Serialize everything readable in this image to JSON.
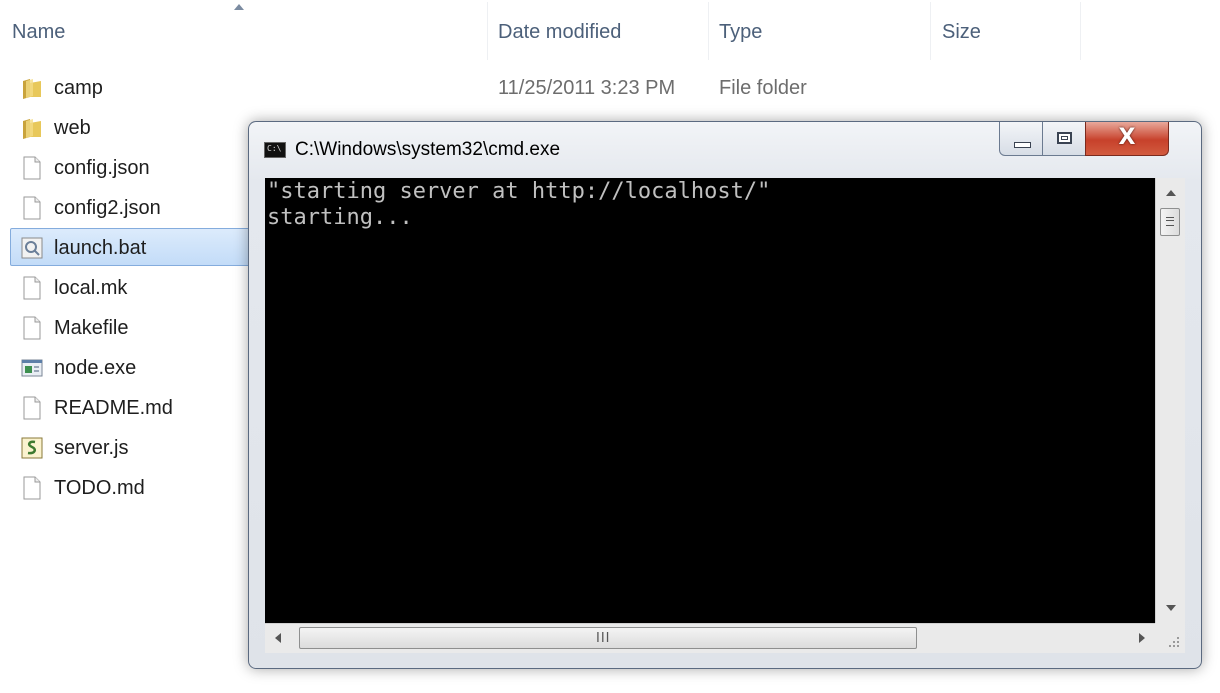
{
  "explorer": {
    "columns": {
      "name": "Name",
      "date_modified": "Date modified",
      "type": "Type",
      "size": "Size"
    },
    "files": [
      {
        "name": "camp",
        "date": "11/25/2011 3:23 PM",
        "type": "File folder",
        "icon": "folder-icon"
      },
      {
        "name": "web",
        "date": "",
        "type": "",
        "icon": "folder-icon"
      },
      {
        "name": "config.json",
        "date": "",
        "type": "",
        "icon": "file-icon"
      },
      {
        "name": "config2.json",
        "date": "",
        "type": "",
        "icon": "file-icon"
      },
      {
        "name": "launch.bat",
        "date": "",
        "type": "",
        "icon": "batch-file-icon",
        "selected": true
      },
      {
        "name": "local.mk",
        "date": "",
        "type": "",
        "icon": "file-icon"
      },
      {
        "name": "Makefile",
        "date": "",
        "type": "",
        "icon": "file-icon"
      },
      {
        "name": "node.exe",
        "date": "",
        "type": "",
        "icon": "executable-icon"
      },
      {
        "name": "README.md",
        "date": "",
        "type": "",
        "icon": "file-icon"
      },
      {
        "name": "server.js",
        "date": "",
        "type": "",
        "icon": "script-file-icon"
      },
      {
        "name": "TODO.md",
        "date": "",
        "type": "",
        "icon": "file-icon"
      }
    ]
  },
  "cmd": {
    "title": "C:\\Windows\\system32\\cmd.exe",
    "lines": [
      "\"starting server at http://localhost/\"",
      "starting..."
    ],
    "close_glyph": "X",
    "scroll_grip": "III"
  },
  "colors": {
    "selection": "#cce4f7",
    "close_button": "#c7412b",
    "console_bg": "#000000",
    "console_fg": "#c0c0c0"
  }
}
